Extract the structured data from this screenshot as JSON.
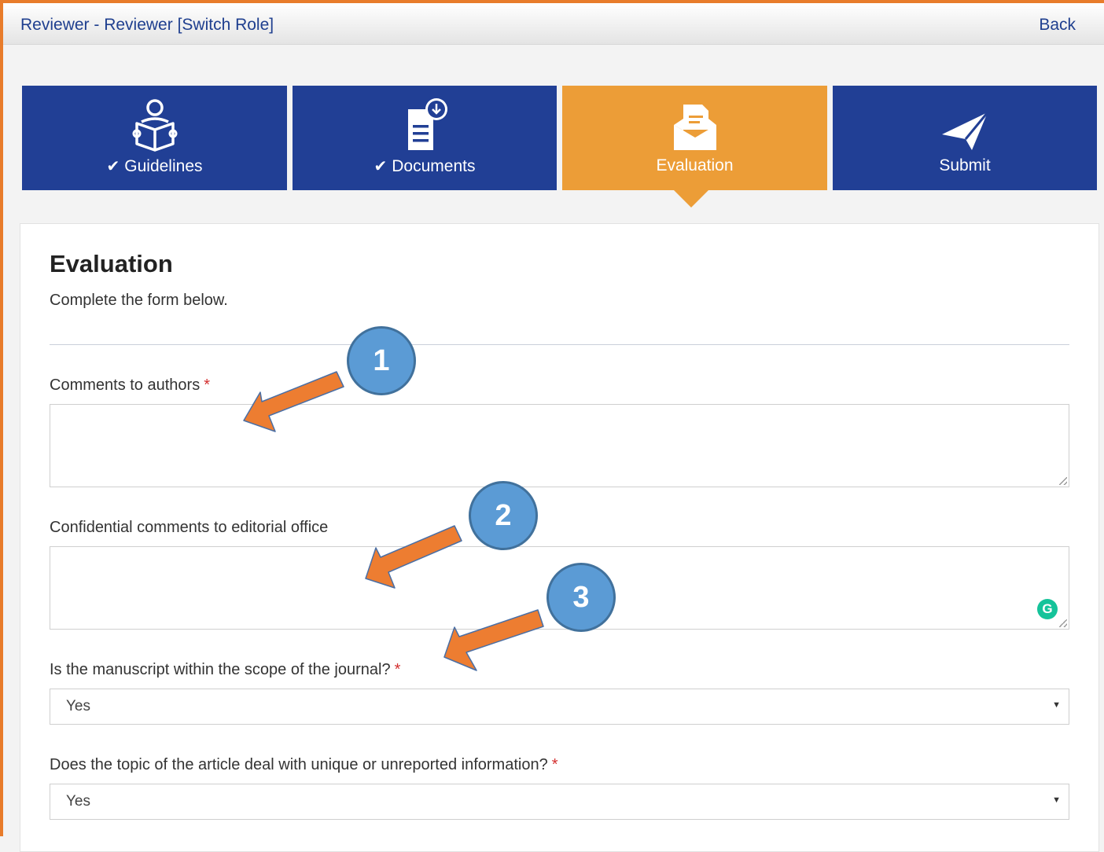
{
  "header": {
    "breadcrumb_role": "Reviewer",
    "breadcrumb_sep": " - ",
    "breadcrumb_rest": "Reviewer [Switch Role]",
    "back_label": "Back"
  },
  "steps": [
    {
      "label": "Guidelines",
      "completed": true,
      "icon": "reader-book-icon"
    },
    {
      "label": "Documents",
      "completed": true,
      "icon": "document-download-icon"
    },
    {
      "label": "Evaluation",
      "completed": false,
      "active": true,
      "icon": "envelope-letter-icon"
    },
    {
      "label": "Submit",
      "completed": false,
      "icon": "paper-plane-icon"
    }
  ],
  "checkmark": "✔",
  "form": {
    "title": "Evaluation",
    "intro": "Complete the form below.",
    "fields": [
      {
        "label": "Comments to authors",
        "required": true,
        "type": "textarea",
        "value": ""
      },
      {
        "label": "Confidential comments to editorial office",
        "required": false,
        "type": "textarea",
        "value": ""
      },
      {
        "label": "Is the manuscript within the scope of the journal?",
        "required": true,
        "type": "select",
        "value": "Yes"
      },
      {
        "label": "Does the topic of the article deal with unique or unreported information?",
        "required": true,
        "type": "select",
        "value": "Yes"
      }
    ],
    "required_marker": "*"
  },
  "annotations": {
    "callouts": [
      "1",
      "2",
      "3"
    ],
    "arrow_color": "#ed7d31",
    "circle_color": "#5b9bd5"
  },
  "colors": {
    "step_bg": "#213f95",
    "step_active_bg": "#ec9d37",
    "frame": "#e87c2b",
    "link": "#1f3f8f",
    "grammarly": "#15c39a"
  },
  "grammarly_glyph": "G"
}
